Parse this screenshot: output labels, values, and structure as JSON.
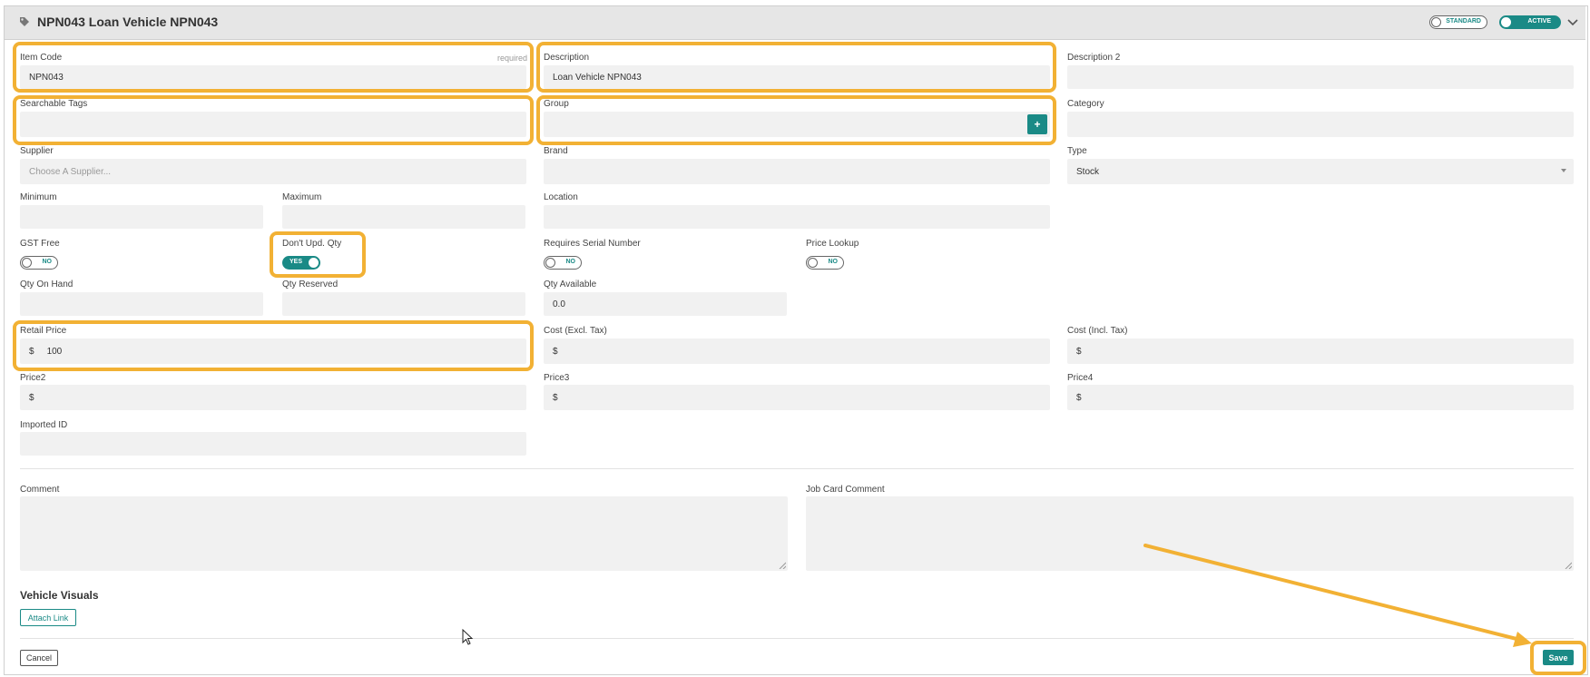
{
  "header": {
    "title": "NPN043 Loan Vehicle NPN043",
    "standard_toggle_label": "STANDARD",
    "active_toggle_label": "ACTIVE"
  },
  "form": {
    "item_code": {
      "label": "Item Code",
      "required": "required",
      "value": "NPN043"
    },
    "description": {
      "label": "Description",
      "value": "Loan Vehicle NPN043"
    },
    "description2": {
      "label": "Description 2",
      "value": ""
    },
    "searchable_tags": {
      "label": "Searchable Tags",
      "value": ""
    },
    "group": {
      "label": "Group",
      "value": "",
      "add_symbol": "+"
    },
    "category": {
      "label": "Category",
      "value": ""
    },
    "supplier": {
      "label": "Supplier",
      "placeholder": "Choose A Supplier..."
    },
    "brand": {
      "label": "Brand",
      "value": ""
    },
    "type": {
      "label": "Type",
      "value": "Stock"
    },
    "minimum": {
      "label": "Minimum",
      "value": ""
    },
    "maximum": {
      "label": "Maximum",
      "value": ""
    },
    "location": {
      "label": "Location",
      "value": ""
    },
    "gst_free": {
      "label": "GST Free",
      "toggle": "NO",
      "on": false
    },
    "dont_upd_qty": {
      "label": "Don't Upd. Qty",
      "toggle": "YES",
      "on": true
    },
    "requires_serial": {
      "label": "Requires Serial Number",
      "toggle": "NO",
      "on": false
    },
    "price_lookup": {
      "label": "Price Lookup",
      "toggle": "NO",
      "on": false
    },
    "qty_on_hand": {
      "label": "Qty On Hand",
      "value": ""
    },
    "qty_reserved": {
      "label": "Qty Reserved",
      "value": ""
    },
    "qty_available": {
      "label": "Qty Available",
      "value": "0.0"
    },
    "retail_price": {
      "label": "Retail Price",
      "currency": "$",
      "value": "100"
    },
    "cost_excl": {
      "label": "Cost (Excl. Tax)",
      "currency": "$",
      "value": ""
    },
    "cost_incl": {
      "label": "Cost (Incl. Tax)",
      "currency": "$",
      "value": ""
    },
    "price2": {
      "label": "Price2",
      "currency": "$",
      "value": ""
    },
    "price3": {
      "label": "Price3",
      "currency": "$",
      "value": ""
    },
    "price4": {
      "label": "Price4",
      "currency": "$",
      "value": ""
    },
    "imported_id": {
      "label": "Imported ID",
      "value": ""
    },
    "comment": {
      "label": "Comment",
      "value": ""
    },
    "job_card_comment": {
      "label": "Job Card Comment",
      "value": ""
    }
  },
  "visuals": {
    "heading": "Vehicle Visuals",
    "attach_label": "Attach Link"
  },
  "footer": {
    "cancel_label": "Cancel",
    "save_label": "Save"
  },
  "colors": {
    "accent": "#1a8a86",
    "highlight": "#f2b134",
    "field_bg": "#f1f1f1",
    "header_bg": "#e6e6e6"
  },
  "icons": {
    "title_icon": "tag-icon",
    "collapse_icon": "chevron-down-icon",
    "cursor": "mouse-pointer-icon"
  }
}
